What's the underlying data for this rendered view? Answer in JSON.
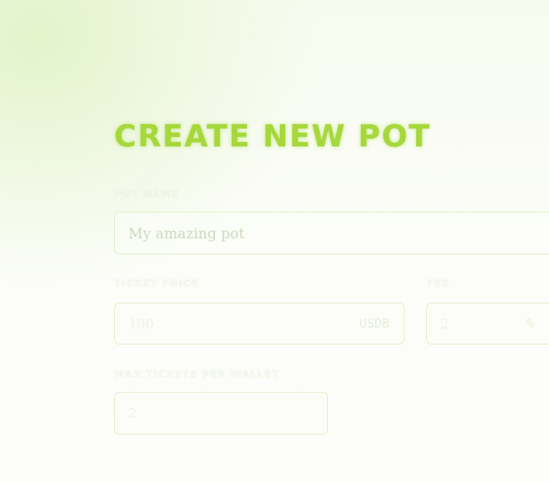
{
  "form": {
    "title": "CREATE NEW POT",
    "pot_name": {
      "label": "POT NAME",
      "placeholder": "My amazing pot"
    },
    "ticket_price": {
      "label": "TICKET PRICE",
      "placeholder": "100",
      "unit": "USDB"
    },
    "fee": {
      "label": "FEE",
      "placeholder": "2",
      "unit": "%"
    },
    "max_tickets": {
      "label": "MAX TICKETS PER WALLET",
      "placeholder": "2"
    }
  },
  "colors": {
    "accent": "#a6d83c",
    "background": "#fcfdf9"
  }
}
